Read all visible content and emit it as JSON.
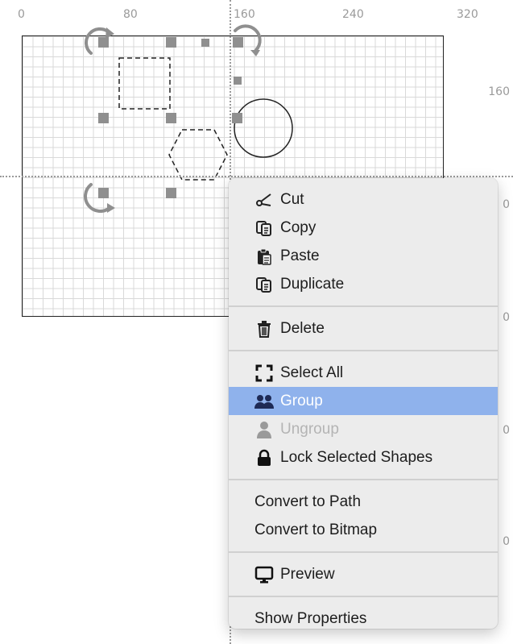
{
  "ruler": {
    "top": [
      "0",
      "80",
      "160",
      "240",
      "320"
    ],
    "side": [
      "160",
      "0",
      "0",
      "0",
      "0"
    ]
  },
  "menu": {
    "items": [
      {
        "label": "Cut",
        "icon": "scissors-icon"
      },
      {
        "label": "Copy",
        "icon": "copy-icon"
      },
      {
        "label": "Paste",
        "icon": "clipboard-icon"
      },
      {
        "label": "Duplicate",
        "icon": "duplicate-icon"
      },
      {
        "label": "Delete",
        "icon": "trash-icon"
      },
      {
        "label": "Select All",
        "icon": "select-all-icon"
      },
      {
        "label": "Group",
        "icon": "group-icon",
        "state": "highlighted"
      },
      {
        "label": "Ungroup",
        "icon": "ungroup-icon",
        "state": "disabled"
      },
      {
        "label": "Lock Selected Shapes",
        "icon": "lock-icon"
      },
      {
        "label": "Convert to Path"
      },
      {
        "label": "Convert to Bitmap"
      },
      {
        "label": "Preview",
        "icon": "monitor-icon"
      },
      {
        "label": "Show Properties"
      }
    ]
  },
  "colors": {
    "highlight": "#8fb2ec",
    "menu_bg": "#ececec",
    "disabled_text": "#b4b4b4",
    "handle": "#8f8f8f"
  }
}
